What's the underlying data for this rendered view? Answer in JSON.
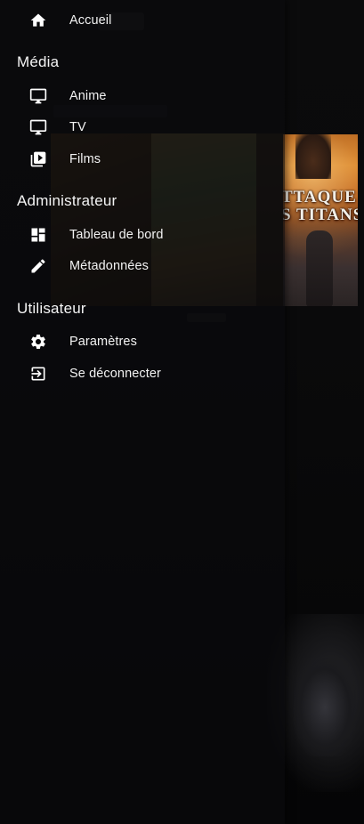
{
  "drawer": {
    "home": {
      "label": "Accueil",
      "icon": "home-icon"
    },
    "sections": [
      {
        "title": "Média",
        "items": [
          {
            "label": "Anime",
            "icon": "monitor-icon"
          },
          {
            "label": "TV",
            "icon": "monitor-icon"
          },
          {
            "label": "Films",
            "icon": "video-library-icon"
          }
        ]
      },
      {
        "title": "Administrateur",
        "items": [
          {
            "label": "Tableau de bord",
            "icon": "dashboard-icon"
          },
          {
            "label": "Métadonnées",
            "icon": "pencil-icon"
          }
        ]
      },
      {
        "title": "Utilisateur",
        "items": [
          {
            "label": "Paramètres",
            "icon": "gear-icon"
          },
          {
            "label": "Se déconnecter",
            "icon": "logout-icon"
          }
        ]
      }
    ]
  },
  "background": {
    "poster_title": [
      "TTAQUE",
      "S TITANS"
    ]
  }
}
